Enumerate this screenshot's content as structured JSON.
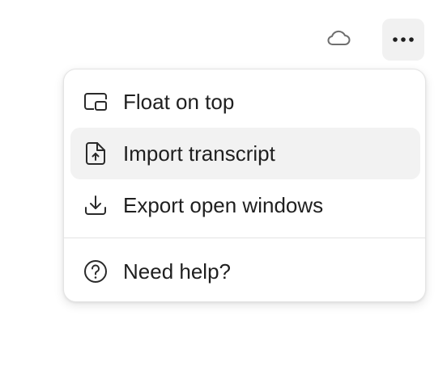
{
  "toolbar": {
    "cloud_icon": "cloud-icon",
    "more_icon": "more-horizontal-icon"
  },
  "menu": {
    "items": [
      {
        "label": "Float on top",
        "icon": "picture-in-picture-icon"
      },
      {
        "label": "Import transcript",
        "icon": "file-upload-icon",
        "highlighted": true
      },
      {
        "label": "Export open windows",
        "icon": "download-icon"
      },
      {
        "label": "Need help?",
        "icon": "question-circle-icon"
      }
    ]
  },
  "colors": {
    "highlight": "#f2f2f2",
    "text": "#1f1f1f",
    "icon": "#2a2a2a",
    "border": "#e4e4e4"
  }
}
